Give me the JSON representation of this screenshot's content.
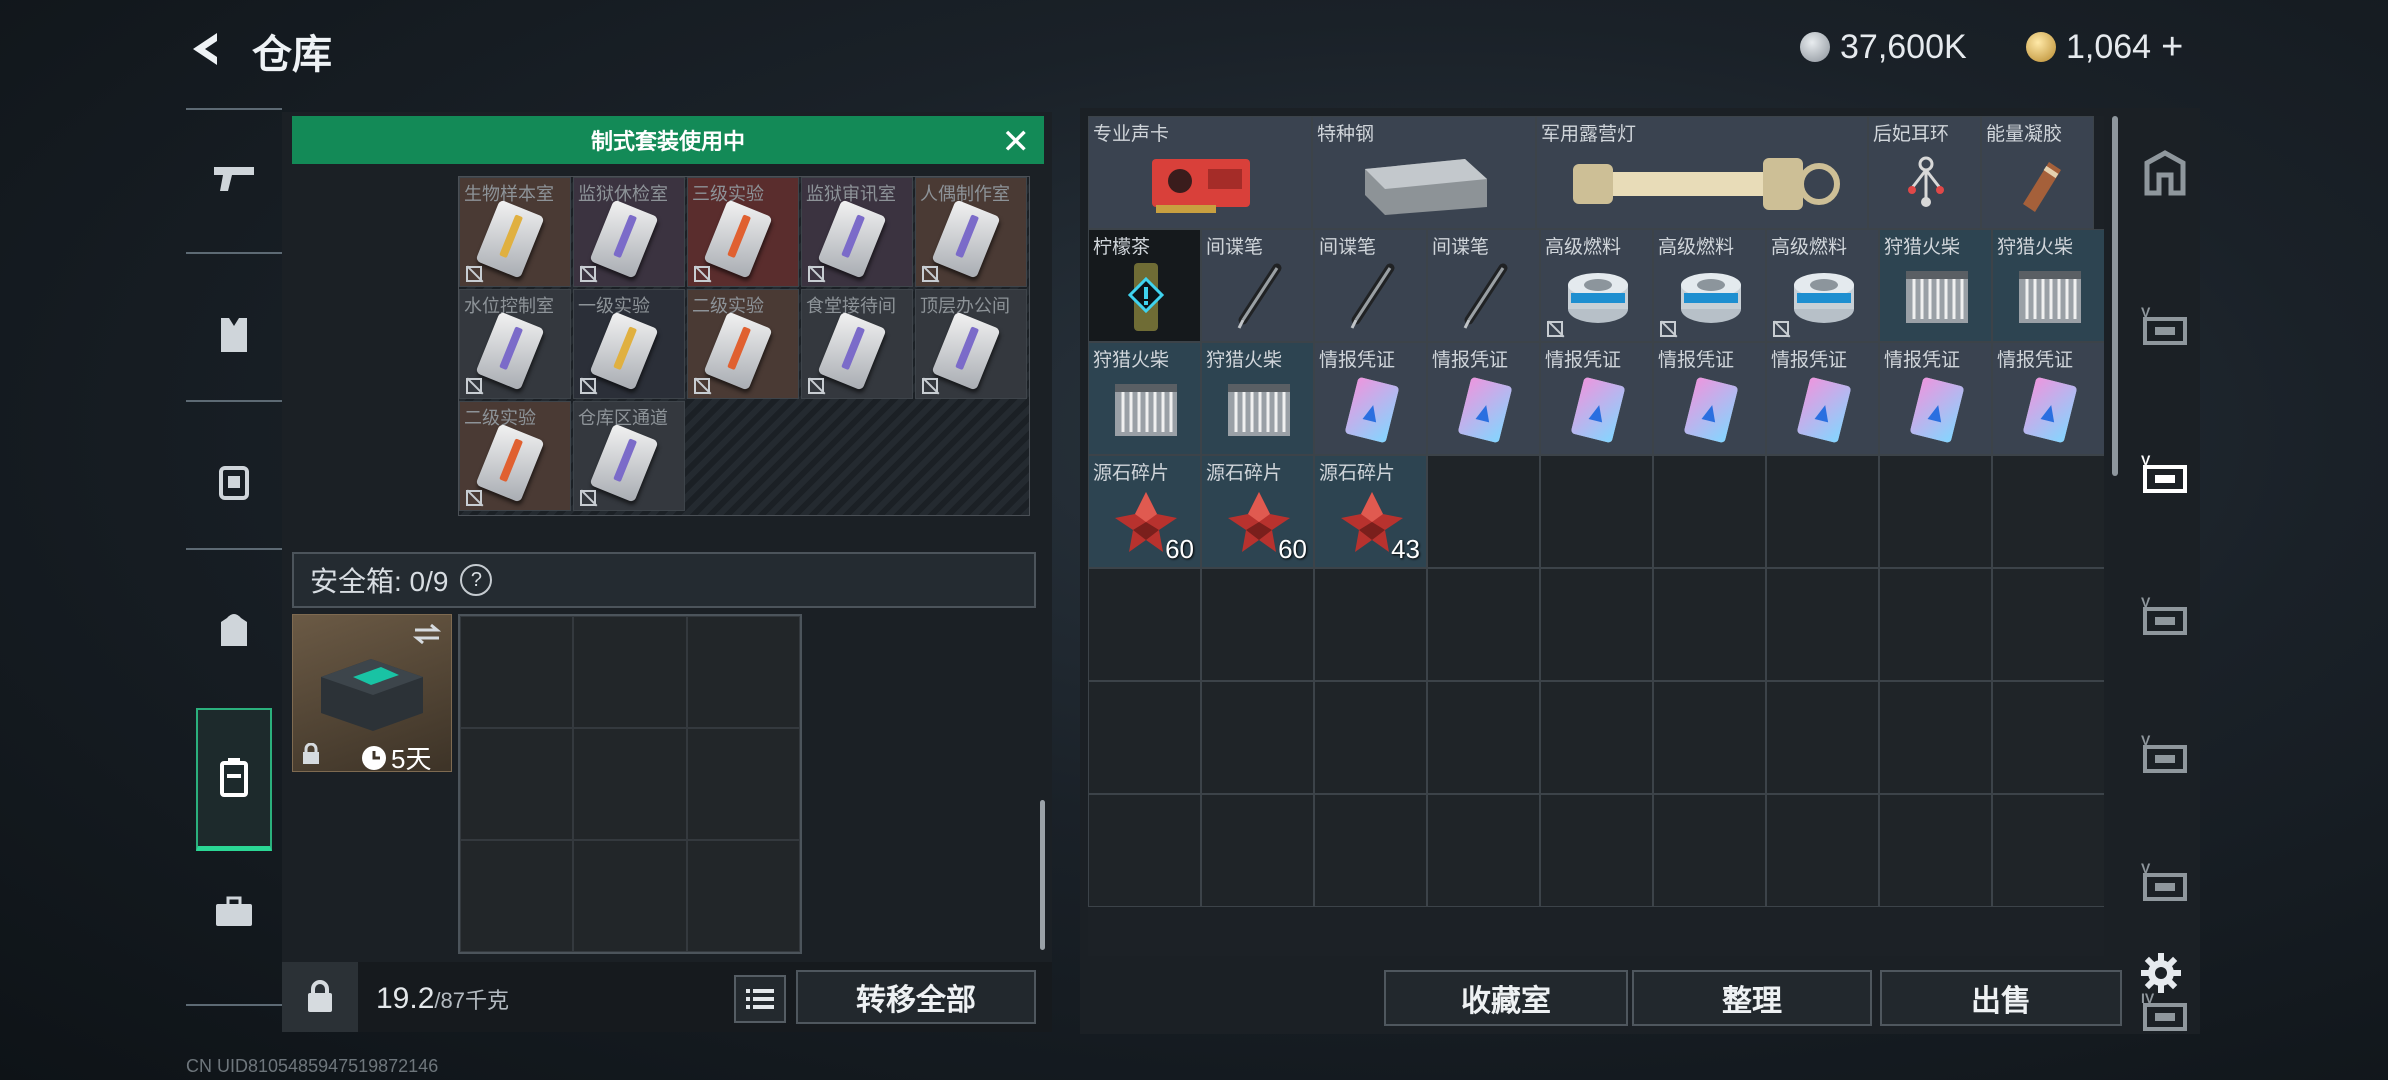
{
  "header": {
    "title": "仓库",
    "currency_silver": "37,600K",
    "currency_gold": "1,064",
    "plus": "+"
  },
  "left_nav": {
    "icons": [
      "gun-icon",
      "armor-vest-icon",
      "chest-rig-icon",
      "backpack-icon",
      "container-icon",
      "briefcase-icon"
    ],
    "active_index": 4
  },
  "loadout": {
    "banner": "制式套装使用中",
    "cells": [
      {
        "label": "生物样本室",
        "color": "#e0b040",
        "bg": "#4a3a34"
      },
      {
        "label": "监狱休检室",
        "color": "#7b6bc9",
        "bg": "#3b3340"
      },
      {
        "label": "三级实验",
        "color": "#e06030",
        "bg": "#5a2d2d"
      },
      {
        "label": "监狱审讯室",
        "color": "#7b6bc9",
        "bg": "#3b3340"
      },
      {
        "label": "人偶制作室",
        "color": "#7b6bc9",
        "bg": "#4a3a34"
      },
      {
        "label": "水位控制室",
        "color": "#7b6bc9",
        "bg": "#34383e"
      },
      {
        "label": "一级实验",
        "color": "#e0b040",
        "bg": "#2b2f38"
      },
      {
        "label": "二级实验",
        "color": "#e06030",
        "bg": "#4a3a34"
      },
      {
        "label": "食堂接待间",
        "color": "#7b6bc9",
        "bg": "#34383e"
      },
      {
        "label": "顶层办公间",
        "color": "#7b6bc9",
        "bg": "#34383e"
      },
      {
        "label": "二级实验",
        "color": "#e06030",
        "bg": "#4a3a34"
      },
      {
        "label": "仓库区通道",
        "color": "#7b6bc9",
        "bg": "#34383e"
      }
    ]
  },
  "safebox": {
    "label": "安全箱: 0/9",
    "help": "?",
    "item_timer": "5天"
  },
  "bottom": {
    "weight": "19.2",
    "weight_max": "/87千克",
    "transfer_all": "转移全部"
  },
  "inventory": {
    "items": [
      {
        "label": "专业声卡",
        "icon": "sound-card-icon",
        "bg": "gray",
        "count": ""
      },
      {
        "label": "特种钢",
        "icon": "steel-bar-icon",
        "bg": "gray",
        "count": ""
      },
      {
        "label": "军用露营灯",
        "icon": "camping-lantern-icon",
        "bg": "gray",
        "count": ""
      },
      {
        "label": "后妃耳环",
        "icon": "earring-icon",
        "bg": "gray",
        "count": ""
      },
      {
        "label": "能量凝胶",
        "icon": "energy-gel-icon",
        "bg": "gray",
        "count": ""
      },
      {
        "label": "柠檬茶",
        "icon": "lemon-tea-icon",
        "bg": "dark",
        "count": ""
      },
      {
        "label": "间谍笔",
        "icon": "spy-pen-icon",
        "bg": "gray",
        "count": ""
      },
      {
        "label": "间谍笔",
        "icon": "spy-pen-icon",
        "bg": "gray",
        "count": ""
      },
      {
        "label": "间谍笔",
        "icon": "spy-pen-icon",
        "bg": "gray",
        "count": ""
      },
      {
        "label": "高级燃料",
        "icon": "fuel-can-icon",
        "bg": "gray",
        "count": ""
      },
      {
        "label": "高级燃料",
        "icon": "fuel-can-icon",
        "bg": "gray",
        "count": ""
      },
      {
        "label": "高级燃料",
        "icon": "fuel-can-icon",
        "bg": "gray",
        "count": ""
      },
      {
        "label": "狩猎火柴",
        "icon": "matches-icon",
        "bg": "teal",
        "count": ""
      },
      {
        "label": "狩猎火柴",
        "icon": "matches-icon",
        "bg": "teal",
        "count": ""
      },
      {
        "label": "狩猎火柴",
        "icon": "matches-icon",
        "bg": "teal",
        "count": ""
      },
      {
        "label": "狩猎火柴",
        "icon": "matches-icon",
        "bg": "teal",
        "count": ""
      },
      {
        "label": "情报凭证",
        "icon": "intel-card-icon",
        "bg": "gray",
        "count": ""
      },
      {
        "label": "情报凭证",
        "icon": "intel-card-icon",
        "bg": "gray",
        "count": ""
      },
      {
        "label": "情报凭证",
        "icon": "intel-card-icon",
        "bg": "gray",
        "count": ""
      },
      {
        "label": "情报凭证",
        "icon": "intel-card-icon",
        "bg": "gray",
        "count": ""
      },
      {
        "label": "情报凭证",
        "icon": "intel-card-icon",
        "bg": "gray",
        "count": ""
      },
      {
        "label": "情报凭证",
        "icon": "intel-card-icon",
        "bg": "gray",
        "count": ""
      },
      {
        "label": "情报凭证",
        "icon": "intel-card-icon",
        "bg": "gray",
        "count": ""
      },
      {
        "label": "源石碎片",
        "icon": "crystal-shard-icon",
        "bg": "teal",
        "count": "60"
      },
      {
        "label": "源石碎片",
        "icon": "crystal-shard-icon",
        "bg": "teal",
        "count": "60"
      },
      {
        "label": "源石碎片",
        "icon": "crystal-shard-icon",
        "bg": "teal",
        "count": "43"
      }
    ],
    "buttons": {
      "collection": "收藏室",
      "organize": "整理",
      "sell": "出售"
    }
  },
  "right_nav": {
    "icons": [
      "warehouse-home-icon",
      "storage-tab-5-icon",
      "storage-tab-6-icon",
      "storage-tab-7-icon",
      "storage-tab-8-icon",
      "storage-tab-9-icon",
      "storage-tab-4-icon"
    ],
    "labels": [
      "",
      "V",
      "V",
      "V",
      "V",
      "V",
      "IV"
    ],
    "active_index": 2
  },
  "status": {
    "text": "CN UID8105485947519872146"
  }
}
